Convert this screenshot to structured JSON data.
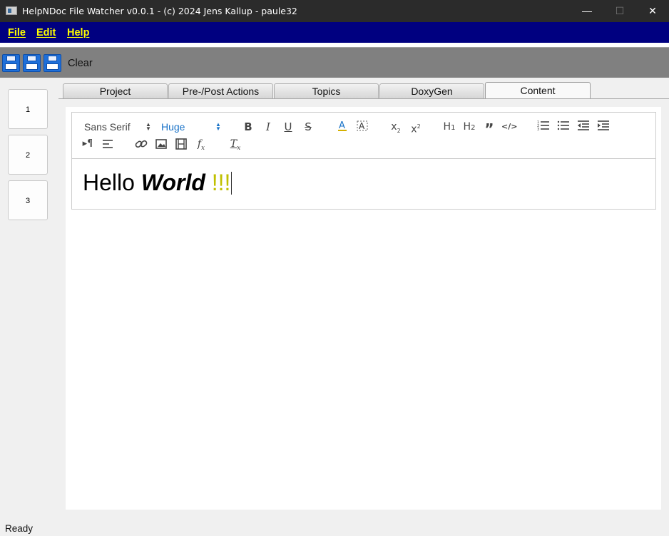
{
  "window": {
    "title": "HelpNDoc File Watcher v0.0.1 - (c) 2024 Jens Kallup - paule32",
    "minimize_glyph": "—",
    "maximize_glyph": "☐",
    "close_glyph": "✕"
  },
  "menubar": {
    "items": [
      {
        "label": "File"
      },
      {
        "label": "Edit"
      },
      {
        "label": "Help"
      }
    ],
    "background": "#000080",
    "text_color": "#ffff00"
  },
  "toolbar": {
    "icons": [
      "save-icon",
      "save-as-icon",
      "save-all-icon"
    ],
    "clear_label": "Clear"
  },
  "sidebar": {
    "buttons": [
      {
        "label": "1"
      },
      {
        "label": "2"
      },
      {
        "label": "3"
      }
    ]
  },
  "tabs": [
    {
      "label": "Project"
    },
    {
      "label": "Pre-/Post Actions"
    },
    {
      "label": "Topics"
    },
    {
      "label": "DoxyGen"
    },
    {
      "label": "Content",
      "active": true
    }
  ],
  "editor": {
    "font_family_value": "Sans Serif",
    "font_size_value": "Huge",
    "font_size_color": "#06c",
    "format_buttons": [
      "bold-icon",
      "italic-icon",
      "underline-icon",
      "strike-icon",
      "text-color-icon",
      "background-color-icon",
      "subscript-icon",
      "superscript-icon",
      "heading1-icon",
      "heading2-icon",
      "blockquote-icon",
      "code-block-icon",
      "ordered-list-icon",
      "bullet-list-icon",
      "outdent-icon",
      "indent-icon",
      "text-direction-icon",
      "align-icon",
      "link-icon",
      "image-icon",
      "video-icon",
      "formula-icon",
      "clean-format-icon"
    ],
    "content": {
      "hello": "Hello ",
      "world": "World",
      "bang": " !!!"
    }
  },
  "status": {
    "text": "Ready"
  }
}
